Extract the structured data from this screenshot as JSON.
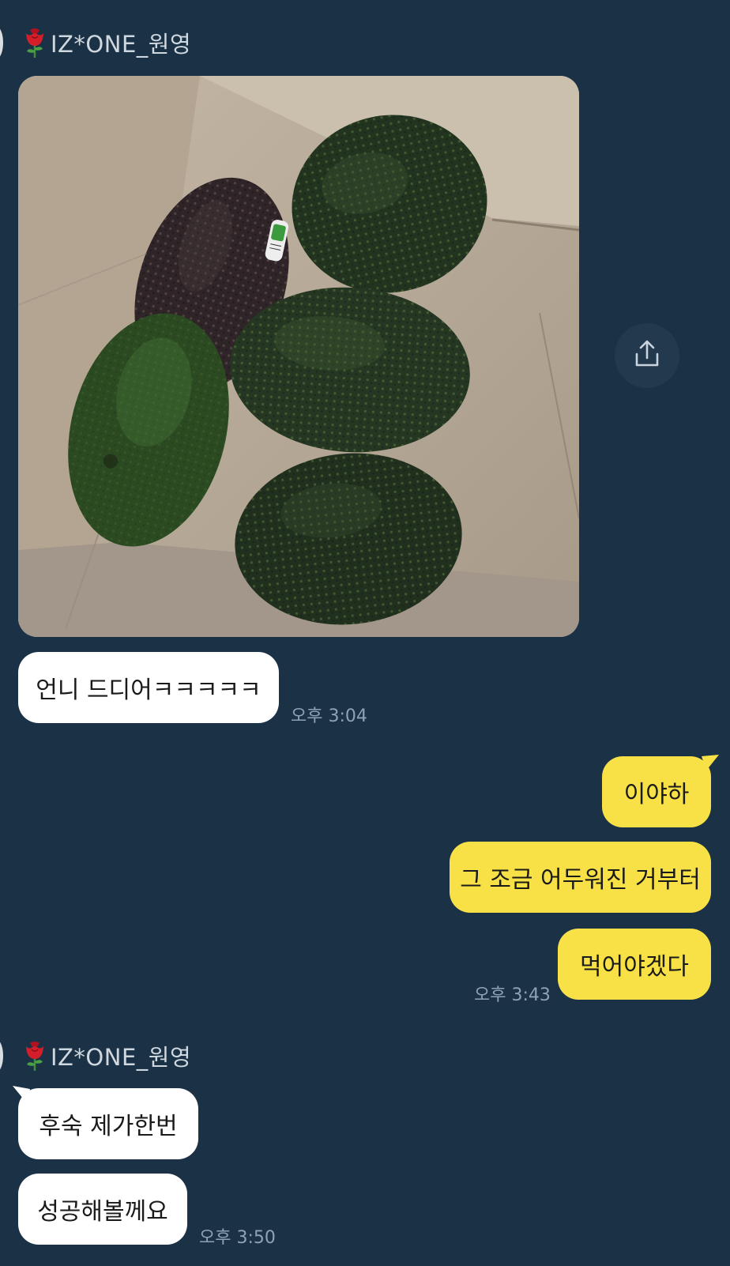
{
  "chat": {
    "sender_name": "IZ*ONE_원영",
    "messages": {
      "m1": {
        "text": "언니 드디어ㅋㅋㅋㅋㅋ",
        "time": "오후 3:04"
      },
      "m2": {
        "text": "이야하"
      },
      "m3": {
        "text": "그 조금 어두워진 거부터"
      },
      "m4": {
        "text": "먹어야겠다",
        "time": "오후 3:43"
      },
      "m5": {
        "text": "후숙 제가한번"
      },
      "m6": {
        "text": "성공해볼께요",
        "time": "오후 3:50"
      }
    }
  },
  "icons": {
    "sender_badge": "rose-icon",
    "share": "share-icon"
  },
  "colors": {
    "background": "#1b3146",
    "incoming_bubble": "#ffffff",
    "outgoing_bubble": "#f8e146",
    "time_text": "#8fa2b3",
    "sender_text": "#cfd7df"
  }
}
